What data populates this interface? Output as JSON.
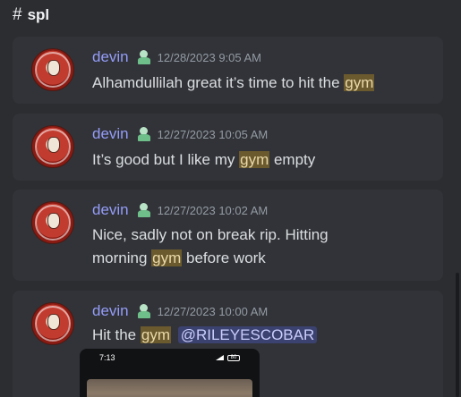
{
  "channel": {
    "icon": "hash-icon",
    "symbol": "#",
    "name": "spl"
  },
  "messages": [
    {
      "author": "devin",
      "timestamp": "12/28/2023 9:05 AM",
      "segments": [
        {
          "text": "Alhamdullilah great it’s time to hit the ",
          "type": "plain"
        },
        {
          "text": "gym",
          "type": "highlight"
        }
      ]
    },
    {
      "author": "devin",
      "timestamp": "12/27/2023 10:05 AM",
      "segments": [
        {
          "text": "It’s good but I like my ",
          "type": "plain"
        },
        {
          "text": "gym",
          "type": "highlight"
        },
        {
          "text": " empty",
          "type": "plain"
        }
      ]
    },
    {
      "author": "devin",
      "timestamp": "12/27/2023 10:02 AM",
      "segments": [
        {
          "text": "Nice, sadly not on break rip. Hitting morning ",
          "type": "plain"
        },
        {
          "text": "gym",
          "type": "highlight"
        },
        {
          "text": " before work",
          "type": "plain"
        }
      ]
    },
    {
      "author": "devin",
      "timestamp": "12/27/2023 10:00 AM",
      "segments": [
        {
          "text": "Hit the ",
          "type": "plain"
        },
        {
          "text": "gym",
          "type": "highlight"
        },
        {
          "text": " ",
          "type": "plain"
        },
        {
          "text": "@RILEYESCOBAR",
          "type": "mention"
        }
      ]
    }
  ],
  "attachment": {
    "status_time": "7:13",
    "battery": "80"
  },
  "colors": {
    "background": "#2b2d31",
    "card": "#313338",
    "author": "#949cf7",
    "highlight": "#6b5a2e",
    "mention": "#3c4270"
  }
}
